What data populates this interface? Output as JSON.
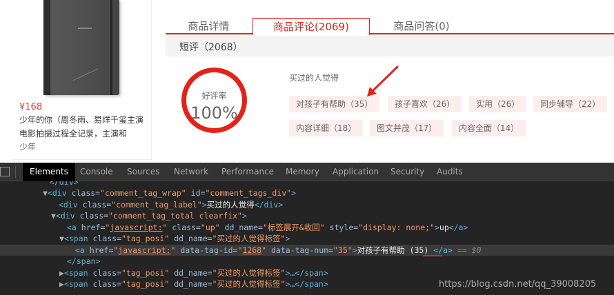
{
  "product": {
    "price": "¥168",
    "title": "少年的你（周冬雨、易烊千玺主演电影拍摄过程全记录，主演和",
    "title_more": "少年"
  },
  "tabs": [
    "商品详情",
    "商品评论(2069)",
    "商品问答(0)"
  ],
  "short_review": "短评（2068）",
  "rating": {
    "label": "好评率",
    "value": "100%"
  },
  "tags_label": "买过的人觉得",
  "tags": [
    "对孩子有帮助（35）",
    "孩子喜欢（26）",
    "实用（26）",
    "同步辅导（22）",
    "内容详细（18）",
    "图文并茂（17）",
    "内容全面（14）"
  ],
  "colors": {
    "accent": "#e2231a",
    "tag_bg": "#fdeeee",
    "devtools_bg": "#242424"
  },
  "devtools": {
    "tabs": [
      "Elements",
      "Console",
      "Sources",
      "Network",
      "Performance",
      "Memory",
      "Application",
      "Security",
      "Audits"
    ],
    "lines": {
      "l0": {
        "text": "</div>"
      },
      "l1": {
        "tri": "▼",
        "open": "<div ",
        "a1": "class=",
        "v1": "\"comment_tag_wrap\"",
        "a2": " id=",
        "v2": "\"comment_tags_div\"",
        "close": ">"
      },
      "l2": {
        "open": "<div ",
        "a1": "class=",
        "v1": "\"comment_tag_label\"",
        "close": ">",
        "text": "买过的人觉得",
        "end": "</div>"
      },
      "l3": {
        "tri": "▼",
        "open": "<div ",
        "a1": "class=",
        "v1": "\"comment_tag_total clearfix\"",
        "close": ">"
      },
      "l4": {
        "open": "<a ",
        "a1": "href=",
        "v1q": "\"",
        "v1": "javascript:",
        "v1e": "\"",
        "a2": " class=",
        "v2": "\"up\"",
        "a3": " dd_name=",
        "v3": "\"标签展开&收回\"",
        "a4": " style=",
        "v4": "\"display: none;\"",
        "close": ">",
        "text": "up",
        "end": "</a>"
      },
      "l5": {
        "tri": "▼",
        "open": "<span ",
        "a1": "class=",
        "v1": "\"tag_posi\"",
        "a2": " dd_name=",
        "v2": "\"买过的人觉得标签\"",
        "close": ">"
      },
      "l6": {
        "open": "<a ",
        "a1": "href=",
        "v1q": "\"",
        "v1": "javascript:",
        "v1e": "\"",
        "a2": " data-tag-id=",
        "v2q": "\"",
        "v2": "1268",
        "v2e": "\"",
        "a3": " data-tag-num=",
        "v3": "\"35\"",
        "close": ">",
        "text": "对孩子有帮助 ",
        "num": "(35)",
        "end": " </a>",
        "eq": " == $0"
      },
      "l7": {
        "end": "</span>"
      },
      "l8": {
        "tri": "▶",
        "open": "<span ",
        "a1": "class=",
        "v1": "\"tag_posi\"",
        "a2": " dd_name=",
        "v2": "\"买过的人觉得标签\"",
        "close": ">…</span>"
      },
      "l9": {
        "tri": "▶",
        "open": "<span ",
        "a1": "class=",
        "v1": "\"tag_posi\"",
        "a2": " dd_name=",
        "v2": "\"买过的人觉得标签\"",
        "close": ">…</span>"
      }
    },
    "watermark": "https://blog.csdn.net/qq_39008205"
  }
}
